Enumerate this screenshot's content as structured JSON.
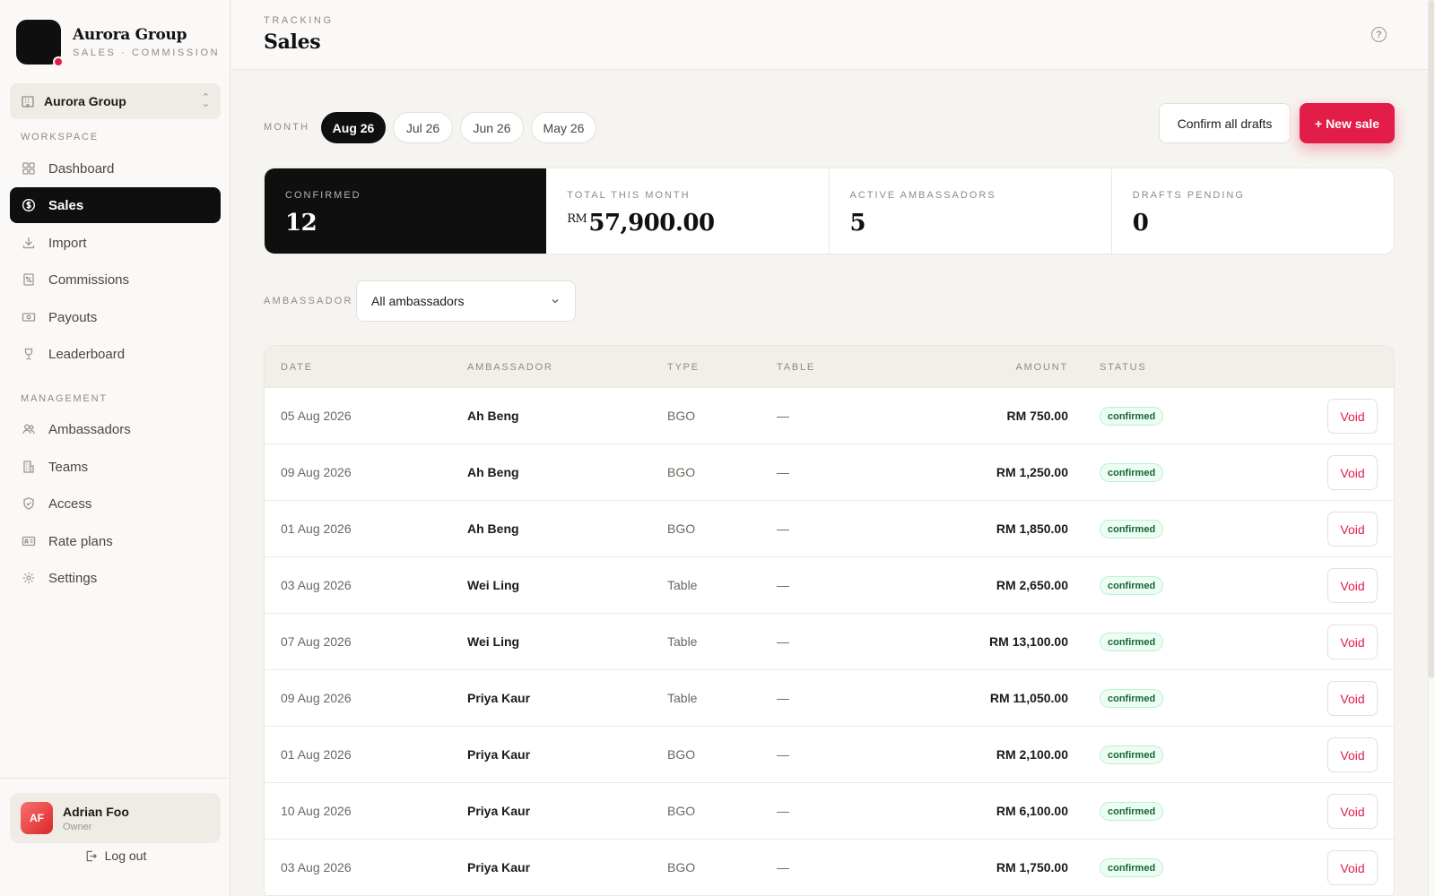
{
  "brand": {
    "title": "Aurora Group",
    "subtitle": "SALES · COMMISSION"
  },
  "org_select": {
    "value": "Aurora Group"
  },
  "sidebar": {
    "workspace_label": "WORKSPACE",
    "management_label": "MANAGEMENT",
    "workspace_items": [
      {
        "label": "Dashboard",
        "icon": "grid-icon"
      },
      {
        "label": "Sales",
        "icon": "dollar-circle-icon",
        "active": true
      },
      {
        "label": "Import",
        "icon": "download-icon"
      },
      {
        "label": "Commissions",
        "icon": "percent-doc-icon"
      },
      {
        "label": "Payouts",
        "icon": "cash-icon"
      },
      {
        "label": "Leaderboard",
        "icon": "trophy-icon"
      }
    ],
    "management_items": [
      {
        "label": "Ambassadors",
        "icon": "users-icon"
      },
      {
        "label": "Teams",
        "icon": "building-icon"
      },
      {
        "label": "Access",
        "icon": "shield-icon"
      },
      {
        "label": "Rate plans",
        "icon": "id-card-icon"
      },
      {
        "label": "Settings",
        "icon": "gear-icon"
      }
    ]
  },
  "user": {
    "initials": "AF",
    "name": "Adrian Foo",
    "role": "Owner"
  },
  "logout_label": "Log out",
  "header": {
    "eyebrow": "TRACKING",
    "title": "Sales"
  },
  "month_filter": {
    "label": "MONTH",
    "options": [
      "Aug 26",
      "Jul 26",
      "Jun 26",
      "May 26"
    ],
    "selected": "Aug 26"
  },
  "actions": {
    "confirm_all": "Confirm all drafts",
    "new_sale": "+ New sale"
  },
  "stats": [
    {
      "label": "CONFIRMED",
      "value": "12"
    },
    {
      "label": "TOTAL THIS MONTH",
      "prefix": "RM",
      "value": "57,900.00"
    },
    {
      "label": "ACTIVE AMBASSADORS",
      "value": "5"
    },
    {
      "label": "DRAFTS PENDING",
      "value": "0"
    }
  ],
  "ambassador_filter": {
    "label": "AMBASSADOR",
    "value": "All ambassadors"
  },
  "table": {
    "columns": [
      "DATE",
      "AMBASSADOR",
      "TYPE",
      "TABLE",
      "AMOUNT",
      "STATUS"
    ],
    "void_label": "Void",
    "rows": [
      {
        "date": "05 Aug 2026",
        "ambassador": "Ah Beng",
        "type": "BGO",
        "table": "—",
        "amount": "RM 750.00",
        "status": "confirmed"
      },
      {
        "date": "09 Aug 2026",
        "ambassador": "Ah Beng",
        "type": "BGO",
        "table": "—",
        "amount": "RM 1,250.00",
        "status": "confirmed"
      },
      {
        "date": "01 Aug 2026",
        "ambassador": "Ah Beng",
        "type": "BGO",
        "table": "—",
        "amount": "RM 1,850.00",
        "status": "confirmed"
      },
      {
        "date": "03 Aug 2026",
        "ambassador": "Wei Ling",
        "type": "Table",
        "table": "—",
        "amount": "RM 2,650.00",
        "status": "confirmed"
      },
      {
        "date": "07 Aug 2026",
        "ambassador": "Wei Ling",
        "type": "Table",
        "table": "—",
        "amount": "RM 13,100.00",
        "status": "confirmed"
      },
      {
        "date": "09 Aug 2026",
        "ambassador": "Priya Kaur",
        "type": "Table",
        "table": "—",
        "amount": "RM 11,050.00",
        "status": "confirmed"
      },
      {
        "date": "01 Aug 2026",
        "ambassador": "Priya Kaur",
        "type": "BGO",
        "table": "—",
        "amount": "RM 2,100.00",
        "status": "confirmed"
      },
      {
        "date": "10 Aug 2026",
        "ambassador": "Priya Kaur",
        "type": "BGO",
        "table": "—",
        "amount": "RM 6,100.00",
        "status": "confirmed"
      },
      {
        "date": "03 Aug 2026",
        "ambassador": "Priya Kaur",
        "type": "BGO",
        "table": "—",
        "amount": "RM 1,750.00",
        "status": "confirmed"
      }
    ]
  },
  "colors": {
    "accent": "#e11d48",
    "dark": "#0f0f10",
    "success_bg": "#ecfdf3",
    "success_text": "#166534"
  }
}
